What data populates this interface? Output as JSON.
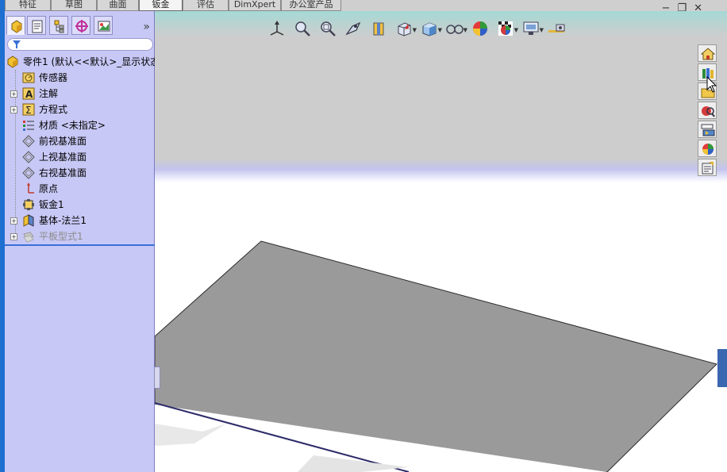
{
  "command_manager": {
    "tabs": [
      {
        "label": "特征",
        "active": false
      },
      {
        "label": "草图",
        "active": false
      },
      {
        "label": "曲面",
        "active": false
      },
      {
        "label": "钣金",
        "active": true
      },
      {
        "label": "评估",
        "active": false
      },
      {
        "label": "DimXpert",
        "active": false
      },
      {
        "label": "办公室产品",
        "active": false
      }
    ]
  },
  "feature_manager": {
    "tabs": [
      "feature-manager-tab-icon",
      "property-manager-tab-icon",
      "configuration-manager-tab-icon",
      "dimxpert-manager-tab-icon",
      "display-manager-tab-icon"
    ],
    "expand_glyph": "»",
    "filter_placeholder": "",
    "tree": [
      {
        "label": "零件1 (默认<<默认>_显示状态",
        "icon": "part-icon",
        "expandable": false,
        "dim": false
      },
      {
        "label": "传感器",
        "icon": "sensor-icon",
        "expandable": false,
        "dim": false
      },
      {
        "label": "注解",
        "icon": "annotation-icon",
        "expandable": true,
        "dim": false
      },
      {
        "label": "方程式",
        "icon": "equation-icon",
        "expandable": true,
        "dim": false
      },
      {
        "label": "材质 <未指定>",
        "icon": "material-icon",
        "expandable": false,
        "dim": false
      },
      {
        "label": "前视基准面",
        "icon": "plane-icon",
        "expandable": false,
        "dim": false
      },
      {
        "label": "上视基准面",
        "icon": "plane-icon",
        "expandable": false,
        "dim": false
      },
      {
        "label": "右视基准面",
        "icon": "plane-icon",
        "expandable": false,
        "dim": false
      },
      {
        "label": "原点",
        "icon": "origin-icon",
        "expandable": false,
        "dim": false
      },
      {
        "label": "钣金1",
        "icon": "sheet-metal-icon",
        "expandable": false,
        "dim": false
      },
      {
        "label": "基体-法兰1",
        "icon": "base-flange-icon",
        "expandable": true,
        "dim": false
      },
      {
        "label": "平板型式1",
        "icon": "flat-pattern-icon",
        "expandable": true,
        "dim": true
      }
    ]
  },
  "heads_up_toolbar": [
    {
      "icon": "triad-icon",
      "dropdown": false
    },
    {
      "icon": "zoom-to-fit-icon",
      "dropdown": false
    },
    {
      "icon": "zoom-to-area-icon",
      "dropdown": false
    },
    {
      "icon": "previous-view-icon",
      "dropdown": false
    },
    {
      "icon": "section-view-icon",
      "dropdown": false
    },
    {
      "icon": "view-orientation-icon",
      "dropdown": true
    },
    {
      "icon": "display-style-icon",
      "dropdown": true
    },
    {
      "icon": "hide-show-items-icon",
      "dropdown": true
    },
    {
      "icon": "edit-appearance-icon",
      "dropdown": false
    },
    {
      "icon": "apply-scene-icon",
      "dropdown": true
    },
    {
      "icon": "view-settings-icon",
      "dropdown": true
    },
    {
      "icon": "camera-icon",
      "dropdown": false
    }
  ],
  "window_controls": {
    "minimize": "−",
    "restore": "❐",
    "close": "✕"
  },
  "task_pane": [
    "home-icon",
    "design-library-icon",
    "file-explorer-icon",
    "search-icon",
    "view-palette-icon",
    "appearances-icon",
    "custom-properties-icon"
  ],
  "colors": {
    "panel_bg": "#c8c8f6",
    "viewport_bg": "#cdcdcd",
    "plate_fill": "#999999",
    "active_tab_bg": "#f4f4f4",
    "accent_blue": "#1e6fd0"
  }
}
